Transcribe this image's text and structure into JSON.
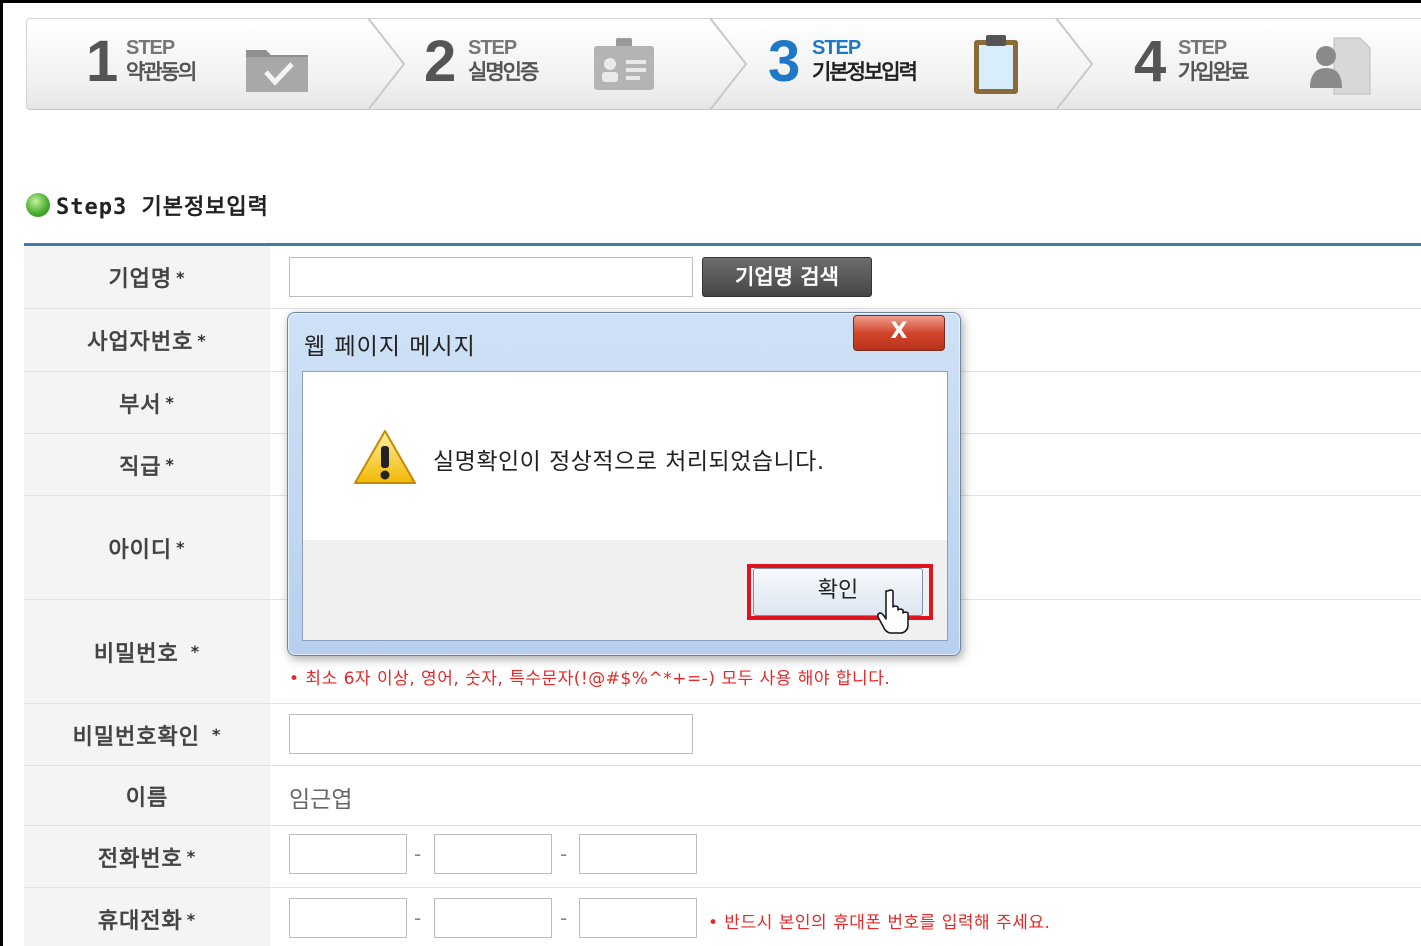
{
  "steps": [
    {
      "number": "1",
      "word": "STEP",
      "title": "약관동의",
      "icon": "folder-check-icon",
      "active": false
    },
    {
      "number": "2",
      "word": "STEP",
      "title": "실명인증",
      "icon": "id-card-icon",
      "active": false
    },
    {
      "number": "3",
      "word": "STEP",
      "title": "기본정보입력",
      "icon": "clipboard-icon",
      "active": true
    },
    {
      "number": "4",
      "word": "STEP",
      "title": "가입완료",
      "icon": "user-document-icon",
      "active": false
    }
  ],
  "section": {
    "title": "Step3 기본정보입력"
  },
  "form": {
    "company": {
      "label": "기업명",
      "value": "",
      "search_button": "기업명 검색"
    },
    "business_no": {
      "label": "사업자번호"
    },
    "department": {
      "label": "부서"
    },
    "position": {
      "label": "직급"
    },
    "user_id": {
      "label": "아이디"
    },
    "password": {
      "label": "비밀번호",
      "hint": "• 최소 6자 이상, 영어, 숫자, 특수문자(!@#$%^*+=-) 모두 사용 해야 합니다."
    },
    "password_confirm": {
      "label": "비밀번호확인",
      "value": ""
    },
    "name": {
      "label": "이름",
      "value": "임근엽"
    },
    "phone": {
      "label": "전화번호",
      "separator": "-"
    },
    "mobile": {
      "label": "휴대전화",
      "separator": "-",
      "hint": "• 반드시 본인의 휴대폰 번호를 입력해 주세요."
    },
    "required_mark": "*"
  },
  "dialog": {
    "title": "웹 페이지 메시지",
    "close_label": "X",
    "message": "실명확인이 정상적으로 처리되었습니다.",
    "icon": "warning-icon",
    "ok_label": "확인"
  },
  "colors": {
    "accent": "#1e78c8",
    "section_line": "#3f7aa8",
    "hint": "#e62828",
    "highlight": "#e0141e"
  }
}
